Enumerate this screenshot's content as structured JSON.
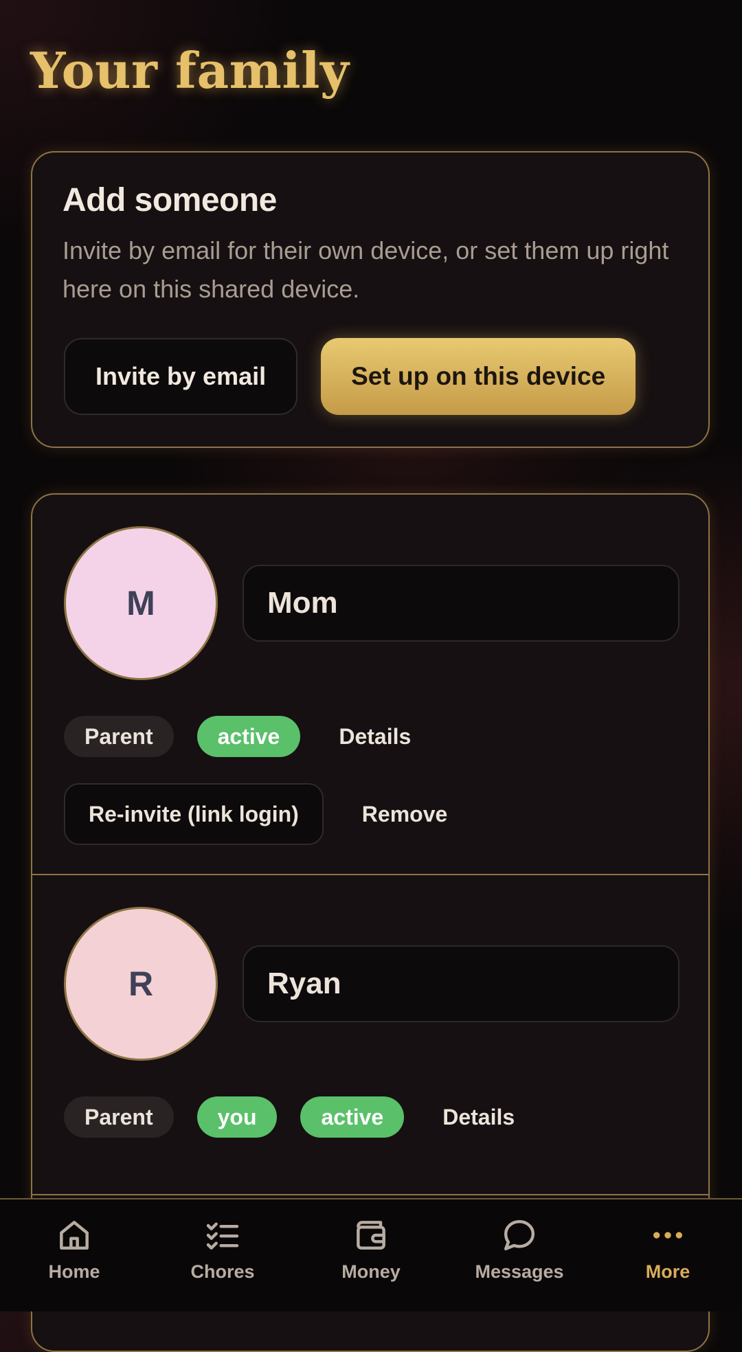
{
  "page": {
    "title": "Your family"
  },
  "add_card": {
    "title": "Add someone",
    "description": "Invite by email for their own device, or set them up right here on this shared device.",
    "invite_label": "Invite by email",
    "setup_label": "Set up on this device"
  },
  "members": [
    {
      "initial": "M",
      "name": "Mom",
      "avatar_color": "#f4d3e8",
      "role": "Parent",
      "status": "active",
      "details_label": "Details",
      "reinvite_label": "Re-invite (link login)",
      "remove_label": "Remove"
    },
    {
      "initial": "R",
      "name": "Ryan",
      "avatar_color": "#f4d1d4",
      "role": "Parent",
      "you_badge": "you",
      "status": "active",
      "details_label": "Details"
    }
  ],
  "nav": {
    "items": [
      {
        "label": "Home",
        "icon": "home-icon"
      },
      {
        "label": "Chores",
        "icon": "checklist-icon"
      },
      {
        "label": "Money",
        "icon": "wallet-icon"
      },
      {
        "label": "Messages",
        "icon": "chat-bubble-icon"
      },
      {
        "label": "More",
        "icon": "more-dots-icon",
        "active": true
      }
    ]
  },
  "colors": {
    "accent_gold": "#e6c06a",
    "status_green": "#5ac06a",
    "background": "#0b0809",
    "card": "#161012"
  }
}
